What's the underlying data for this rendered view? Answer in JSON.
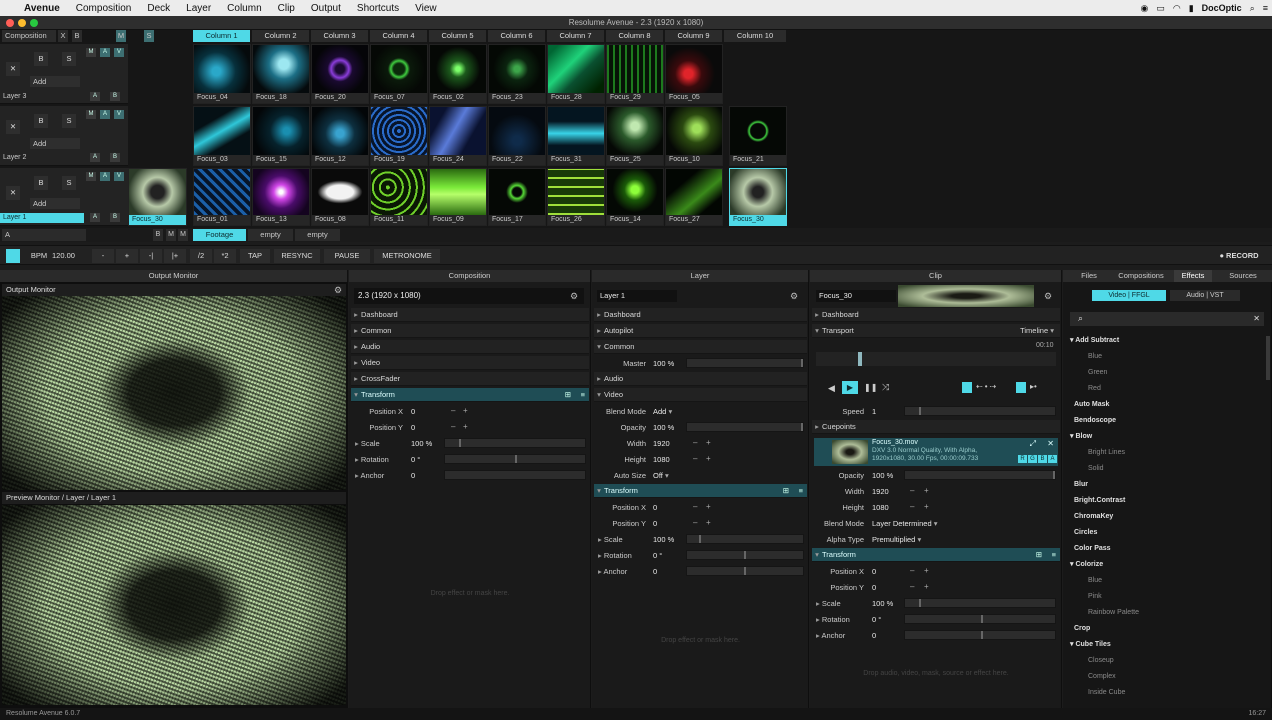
{
  "menubar": {
    "apple": "",
    "app": "Avenue",
    "items": [
      "Composition",
      "Deck",
      "Layer",
      "Column",
      "Clip",
      "Output",
      "Shortcuts",
      "View"
    ],
    "right_app": "DocOptic"
  },
  "window": {
    "title": "Resolume Avenue - 2.3 (1920 x 1080)"
  },
  "composition_header": {
    "label": "Composition",
    "x": "X",
    "b": "B",
    "m": "M",
    "s": "S"
  },
  "columns": [
    "Column 1",
    "Column 2",
    "Column 3",
    "Column 4",
    "Column 5",
    "Column 6",
    "Column 7",
    "Column 8",
    "Column 9",
    "Column 10"
  ],
  "layers": [
    {
      "name": "Layer 3",
      "add": "Add",
      "clips": [
        "Focus_04",
        "Focus_18",
        "Focus_20",
        "Focus_07",
        "Focus_02",
        "Focus_23",
        "Focus_28",
        "Focus_29",
        "Focus_05"
      ]
    },
    {
      "name": "Layer 2",
      "add": "Add",
      "clips": [
        "Focus_03",
        "Focus_15",
        "Focus_12",
        "Focus_19",
        "Focus_24",
        "Focus_22",
        "Focus_31",
        "Focus_25",
        "Focus_10",
        "Focus_21"
      ]
    },
    {
      "name": "Layer 1",
      "add": "Add",
      "preview": "Focus_30",
      "clips": [
        "Focus_01",
        "Focus_13",
        "Focus_08",
        "Focus_11",
        "Focus_09",
        "Focus_17",
        "Focus_26",
        "Focus_14",
        "Focus_27",
        "Focus_30"
      ]
    }
  ],
  "layer_buttons": {
    "x": "✕",
    "b": "B",
    "s": "S",
    "m": "M",
    "a": "A",
    "v": "V",
    "ab_a": "A",
    "ab_b": "B"
  },
  "deck_tabs": {
    "a": "A",
    "b": "B",
    "m": "M",
    "items": [
      "Footage",
      "empty",
      "empty"
    ]
  },
  "transport": {
    "bpm_label": "BPM",
    "bpm": "120.00",
    "minus": "-",
    "plus": "+",
    "dec": "-|",
    "inc": "|+",
    "half": "/2",
    "double": "*2",
    "tap": "TAP",
    "resync": "RESYNC",
    "pause": "PAUSE",
    "metronome": "METRONOME",
    "record": "● RECORD"
  },
  "monitors": {
    "output_header": "Output Monitor",
    "output_label": "Output Monitor",
    "preview_label": "Preview Monitor / Layer / Layer 1"
  },
  "composition_panel": {
    "header": "Composition",
    "name": "2.3 (1920 x 1080)",
    "sections": [
      "Dashboard",
      "Common",
      "Audio",
      "Video",
      "CrossFader",
      "Transform"
    ],
    "props": [
      {
        "label": "Position X",
        "value": "0"
      },
      {
        "label": "Position Y",
        "value": "0"
      },
      {
        "label": "Scale",
        "value": "100 %"
      },
      {
        "label": "Rotation",
        "value": "0 °"
      },
      {
        "label": "Anchor",
        "value": "0"
      }
    ],
    "hint": "Drop effect or mask here."
  },
  "layer_panel": {
    "header": "Layer",
    "name": "Layer 1",
    "sections": [
      "Dashboard",
      "Autopilot",
      "Common",
      "Audio",
      "Video",
      "Transform"
    ],
    "master_label": "Master",
    "master_value": "100 %",
    "video_props": [
      {
        "label": "Blend Mode",
        "value": "Add"
      },
      {
        "label": "Opacity",
        "value": "100 %"
      },
      {
        "label": "Width",
        "value": "1920"
      },
      {
        "label": "Height",
        "value": "1080"
      },
      {
        "label": "Auto Size",
        "value": "Off"
      }
    ],
    "transform_props": [
      {
        "label": "Position X",
        "value": "0"
      },
      {
        "label": "Position Y",
        "value": "0"
      },
      {
        "label": "Scale",
        "value": "100 %"
      },
      {
        "label": "Rotation",
        "value": "0 °"
      },
      {
        "label": "Anchor",
        "value": "0"
      }
    ],
    "hint": "Drop effect or mask here."
  },
  "clip_panel": {
    "header": "Clip",
    "name": "Focus_30",
    "sections": [
      "Dashboard",
      "Transport",
      "Cuepoints",
      "Transform"
    ],
    "timeline": "Timeline",
    "time": "00:10",
    "speed_label": "Speed",
    "speed_value": "1",
    "file": {
      "name": "Focus_30.mov",
      "line1": "DXV 3.0 Normal Quality, With Alpha,",
      "line2": "1920x1080, 30.00 Fps, 00:00:09.733",
      "tags": [
        "R",
        "G",
        "B",
        "A"
      ]
    },
    "props": [
      {
        "label": "Opacity",
        "value": "100 %"
      },
      {
        "label": "Width",
        "value": "1920"
      },
      {
        "label": "Height",
        "value": "1080"
      },
      {
        "label": "Blend Mode",
        "value": "Layer Determined"
      },
      {
        "label": "Alpha Type",
        "value": "Premultiplied"
      }
    ],
    "transform_props": [
      {
        "label": "Position X",
        "value": "0"
      },
      {
        "label": "Position Y",
        "value": "0"
      },
      {
        "label": "Scale",
        "value": "100 %"
      },
      {
        "label": "Rotation",
        "value": "0 °"
      },
      {
        "label": "Anchor",
        "value": "0"
      }
    ],
    "hint": "Drop audio, video, mask, source or effect here."
  },
  "browser": {
    "tabs": [
      "Files",
      "Compositions",
      "Effects",
      "Sources"
    ],
    "subtabs": [
      "Video | FFGL",
      "Audio | VST"
    ],
    "effects": [
      {
        "name": "Add Subtract",
        "group": true
      },
      {
        "name": "Blue"
      },
      {
        "name": "Green"
      },
      {
        "name": "Red"
      },
      {
        "name": "Auto Mask",
        "top": true
      },
      {
        "name": "Bendoscope",
        "top": true
      },
      {
        "name": "Blow",
        "group": true
      },
      {
        "name": "Bright Lines"
      },
      {
        "name": "Solid"
      },
      {
        "name": "Blur",
        "top": true
      },
      {
        "name": "Bright.Contrast",
        "top": true
      },
      {
        "name": "ChromaKey",
        "top": true
      },
      {
        "name": "Circles",
        "top": true
      },
      {
        "name": "Color Pass",
        "top": true
      },
      {
        "name": "Colorize",
        "group": true
      },
      {
        "name": "Blue"
      },
      {
        "name": "Pink"
      },
      {
        "name": "Rainbow Palette"
      },
      {
        "name": "Crop",
        "top": true
      },
      {
        "name": "Cube Tiles",
        "group": true
      },
      {
        "name": "Closeup"
      },
      {
        "name": "Complex"
      },
      {
        "name": "Inside Cube"
      }
    ]
  },
  "status": {
    "left": "Resolume Avenue 6.0.7",
    "right": "16:27"
  }
}
